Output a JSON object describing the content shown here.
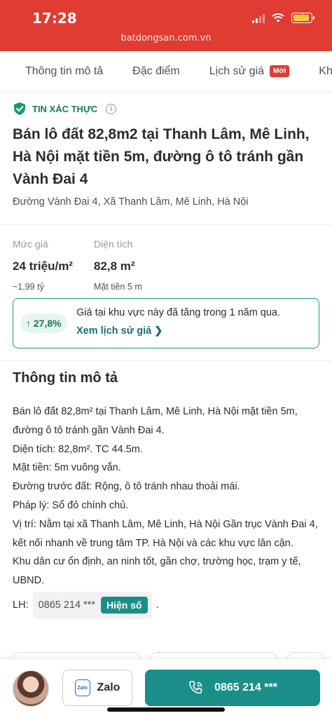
{
  "status": {
    "time": "17:28",
    "url": "batdongsan.com.vn"
  },
  "tabs": [
    {
      "label": "Thông tin mô tả"
    },
    {
      "label": "Đặc điểm"
    },
    {
      "label": "Lịch sử giá",
      "badge": "Mới"
    },
    {
      "label": "Kh"
    }
  ],
  "listing": {
    "verified_label": "TIN XÁC THỰC",
    "title": "Bán lô đất 82,8m2 tại Thanh Lâm, Mê Linh, Hà Nội mặt tiền 5m, đường ô tô tránh gần Vành Đai 4",
    "address": "Đường Vành Đai 4, Xã Thanh Lâm, Mê Linh, Hà Nội"
  },
  "price": {
    "label": "Mức giá",
    "value": "24 triệu/m²",
    "sub": "~1,99 tỷ"
  },
  "area": {
    "label": "Diện tích",
    "value": "82,8 m²",
    "sub": "Mặt tiền 5 m"
  },
  "growth": {
    "percent": "↑ 27,8%",
    "text": "Giá tại khu vực này đã tăng trong 1 năm qua.",
    "link": "Xem lịch sử giá"
  },
  "description": {
    "heading": "Thông tin mô tả",
    "lines": [
      "Bán lô đất 82,8m² tại Thanh Lâm, Mê Linh, Hà Nội mặt tiền 5m, đường ô tô tránh gần Vành Đai 4.",
      "Diện tích: 82,8m². TC 44.5m.",
      "Mặt tiền: 5m vuông vắn.",
      "Đường trước đất: Rộng, ô tô tránh nhau thoải mái.",
      "Pháp lý: Sổ đỏ chính chủ.",
      "Vị trí: Nằm tại xã Thanh Lâm, Mê Linh, Hà Nội Gần trục Vành Đai 4, kết nối nhanh về trung tâm TP. Hà Nội và các khu vực lân cận.",
      "Khu dân cư ổn định, an ninh tốt, gần chợ, trường học, trạm y tế, UBND."
    ],
    "contact_label": "LH:",
    "contact_phone": "0865 214 ***",
    "show_number": "Hiện số",
    "contact_end": "."
  },
  "bottom": {
    "zalo_icon_text": "Zalo",
    "zalo": "Zalo",
    "call_number": "0865 214 ***"
  },
  "colors": {
    "brand": "#e03c31",
    "teal": "#1a8f8a",
    "green": "#1a7c4e"
  }
}
